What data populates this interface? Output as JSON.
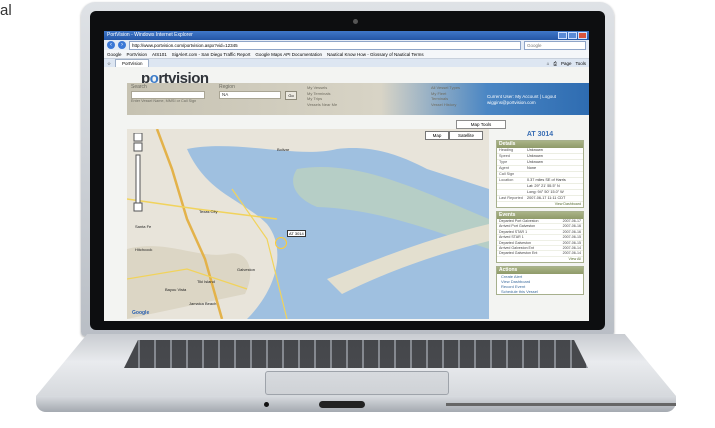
{
  "corner_text": "al",
  "browser": {
    "title": "PortVision - Windows Internet Explorer",
    "url": "http://www.portvision.com/portvision.aspx?vid=12345",
    "search_placeholder": "Google",
    "links": [
      "Google",
      "PortVision",
      "AIS101",
      "SigAlert.com - San Diego Traffic Report",
      "Google Maps API Documentation",
      "Nautical Know How - Glossary of Nautical Terms"
    ],
    "tab_label": "PortVision",
    "tools": [
      "Page",
      "Tools"
    ]
  },
  "header": {
    "logo_pre": "p",
    "logo_o": "o",
    "logo_post": "rtvision",
    "search_label": "Search",
    "search_hint": "Enter Vessel Name, MMSI or Call Sign",
    "region_label": "Region",
    "region_value": "NA",
    "go_label": "Go",
    "search_options": [
      "My Vessels",
      "My Terminals",
      "My Trips",
      "Vessels Near Me"
    ],
    "right_options": [
      "All Vessel Types",
      "My Fleet",
      "Terminals",
      "Vessel History"
    ],
    "user": {
      "label": "Current User:",
      "name": "wiggins@portvision.com",
      "links": "My Account | Logout"
    }
  },
  "map": {
    "tools_label": "Map Tools",
    "types": [
      "Map",
      "Satellite"
    ],
    "places": [
      "Bolivar",
      "Texas City",
      "Galveston",
      "Hitchcock",
      "Santa Fe",
      "Bayou Vista",
      "Tiki Island",
      "Jamaica Beach"
    ],
    "vessel_label": "AT 3014",
    "attribution": "Google"
  },
  "vessel_title": "AT 3014",
  "details": {
    "heading": "Details",
    "rows": [
      {
        "k": "Heading",
        "v": "Unknown"
      },
      {
        "k": "Speed",
        "v": "Unknown"
      },
      {
        "k": "Type",
        "v": "Unknown"
      },
      {
        "k": "Agent",
        "v": "None"
      },
      {
        "k": "Call Sign",
        "v": ""
      },
      {
        "k": "Location",
        "v": "0.37 miles SE of Harris"
      },
      {
        "k": "",
        "v": "Lat: 29° 21' 55.5\" N"
      },
      {
        "k": "",
        "v": "Long: 94° 50' 15.0\" W"
      },
      {
        "k": "Last Reported",
        "v": "2007-06-17 11:11 CDT"
      }
    ],
    "more": "View Dashboard"
  },
  "events": {
    "heading": "Events",
    "rows": [
      {
        "k": "Departed Port Galveston",
        "v": "2007-06-17"
      },
      {
        "k": "Arrived Port Galveston",
        "v": "2007-06-16"
      },
      {
        "k": "Departed STAR 1",
        "v": "2007-06-16"
      },
      {
        "k": "Arrived STAR 1",
        "v": "2007-06-15"
      },
      {
        "k": "Departed Galveston",
        "v": "2007-06-15"
      },
      {
        "k": "Arrived Galveston Ent",
        "v": "2007-06-14"
      },
      {
        "k": "Departed Galveston Ent",
        "v": "2007-06-14"
      }
    ],
    "more": "View All"
  },
  "actions": {
    "heading": "Actions",
    "items": [
      "Create Alert",
      "View Dashboard",
      "Record Event",
      "Schedule this Vessel"
    ]
  }
}
